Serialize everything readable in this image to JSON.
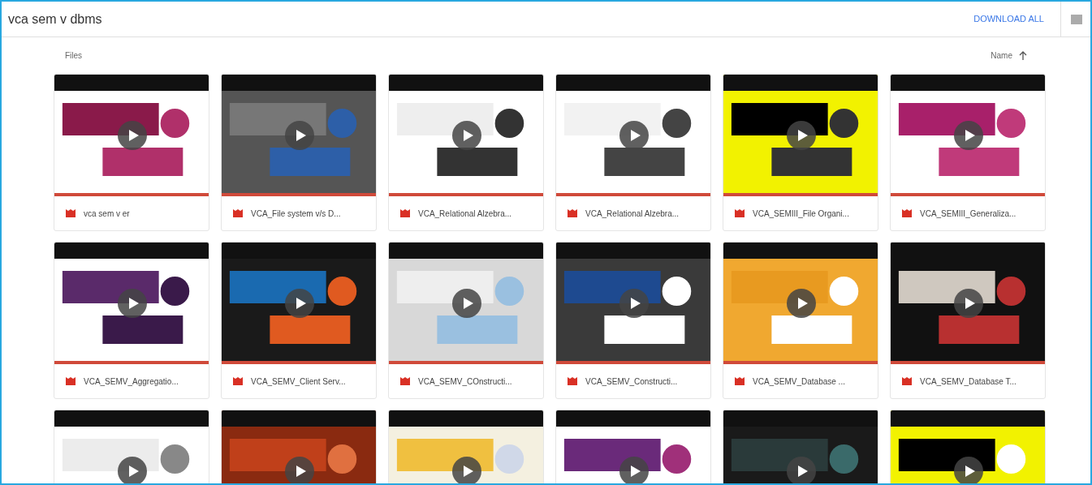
{
  "folder": {
    "title": "vca sem v dbms",
    "download_all": "DOWNLOAD ALL"
  },
  "section": {
    "label": "Files",
    "sort": "Name"
  },
  "files": [
    {
      "name": "vca sem v er",
      "thumbnail": {
        "kind": "picture"
      }
    },
    {
      "name": "VCA_File system v/s D...",
      "thumbnail": {
        "kind": "picture"
      }
    },
    {
      "name": "VCA_Relational Alzebra...",
      "thumbnail": {
        "kind": "picture"
      }
    },
    {
      "name": "VCA_Relational Alzebra...",
      "thumbnail": {
        "kind": "picture"
      }
    },
    {
      "name": "VCA_SEMIII_File Organi...",
      "thumbnail": {
        "kind": "picture"
      }
    },
    {
      "name": "VCA_SEMIII_Generaliza...",
      "thumbnail": {
        "kind": "picture"
      }
    },
    {
      "name": "VCA_SEMV_Aggregatio...",
      "thumbnail": {
        "kind": "picture"
      }
    },
    {
      "name": "VCA_SEMV_Client Serv...",
      "thumbnail": {
        "kind": "picture"
      }
    },
    {
      "name": "VCA_SEMV_COnstructi...",
      "thumbnail": {
        "kind": "picture"
      }
    },
    {
      "name": "VCA_SEMV_Constructi...",
      "thumbnail": {
        "kind": "picture"
      }
    },
    {
      "name": "VCA_SEMV_Database ...",
      "thumbnail": {
        "kind": "picture"
      }
    },
    {
      "name": "VCA_SEMV_Database T...",
      "thumbnail": {
        "kind": "picture"
      }
    },
    {
      "thumbnail": {
        "kind": "picture"
      }
    },
    {
      "thumbnail": {
        "kind": "picture"
      }
    },
    {
      "thumbnail": {
        "kind": "picture"
      }
    },
    {
      "thumbnail": {
        "kind": "picture"
      }
    },
    {
      "thumbnail": {
        "kind": "picture"
      }
    },
    {
      "thumbnail": {
        "kind": "picture"
      }
    }
  ]
}
